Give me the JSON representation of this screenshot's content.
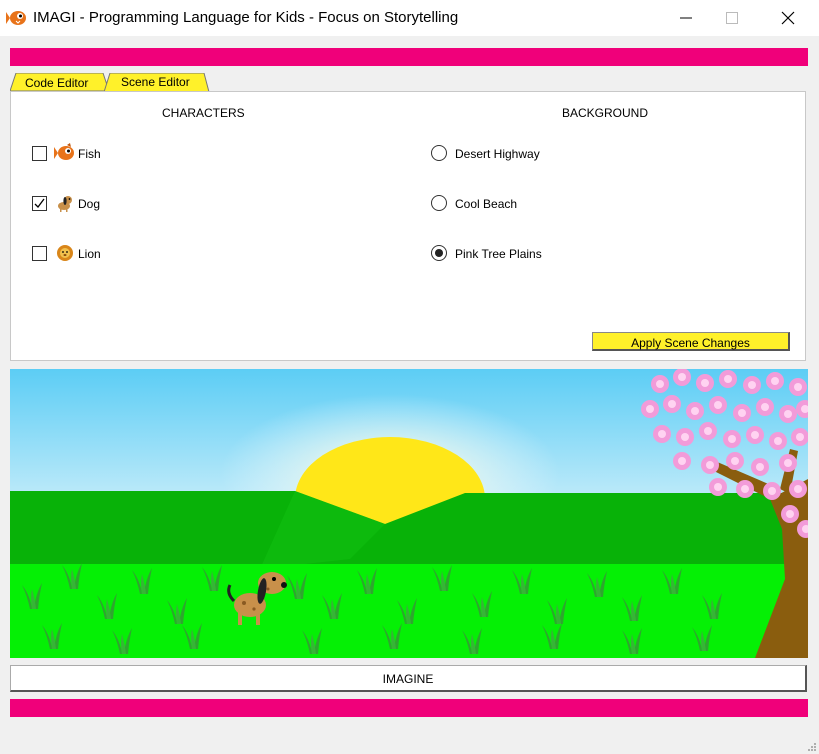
{
  "window": {
    "title": "IMAGI - Programming Language for Kids - Focus on Storytelling",
    "icon": "fish-app-icon",
    "controls": [
      "minimize",
      "maximize",
      "close"
    ]
  },
  "colors": {
    "accent_bar": "#f0007a",
    "tab_fill": "#fff12a",
    "button_fill": "#fff12a"
  },
  "tabs": [
    {
      "label": "Code Editor",
      "active": false
    },
    {
      "label": "Scene Editor",
      "active": true
    }
  ],
  "characters": {
    "title": "CHARACTERS",
    "items": [
      {
        "label": "Fish",
        "icon": "fish-icon",
        "checked": false
      },
      {
        "label": "Dog",
        "icon": "dog-icon",
        "checked": true
      },
      {
        "label": "Lion",
        "icon": "lion-icon",
        "checked": false
      }
    ]
  },
  "background": {
    "title": "BACKGROUND",
    "options": [
      {
        "label": "Desert Highway",
        "selected": false
      },
      {
        "label": "Cool Beach",
        "selected": false
      },
      {
        "label": "Pink Tree Plains",
        "selected": true
      }
    ]
  },
  "apply_button": "Apply Scene Changes",
  "scene": {
    "background": "Pink Tree Plains",
    "characters": [
      "dog"
    ]
  },
  "imagine_button": "IMAGINE"
}
